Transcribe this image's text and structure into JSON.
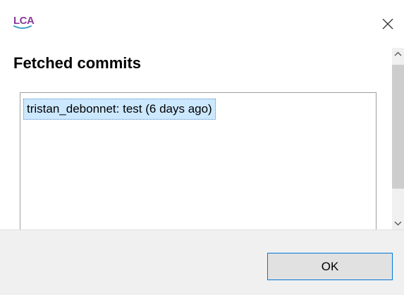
{
  "app": {
    "logo_text": "LCA",
    "logo_color": "#8a3a9a",
    "logo_accent": "#3aa0c8"
  },
  "dialog": {
    "heading": "Fetched commits",
    "commits": [
      {
        "label": "tristan_debonnet: test (6 days ago)"
      }
    ],
    "ok_label": "OK"
  },
  "icons": {
    "close": "close-icon",
    "scroll_up": "chevron-up-icon",
    "scroll_down": "chevron-down-icon"
  },
  "colors": {
    "selection_bg": "#cce8ff",
    "button_border": "#0078d7",
    "footer_bg": "#f0f0f0"
  }
}
